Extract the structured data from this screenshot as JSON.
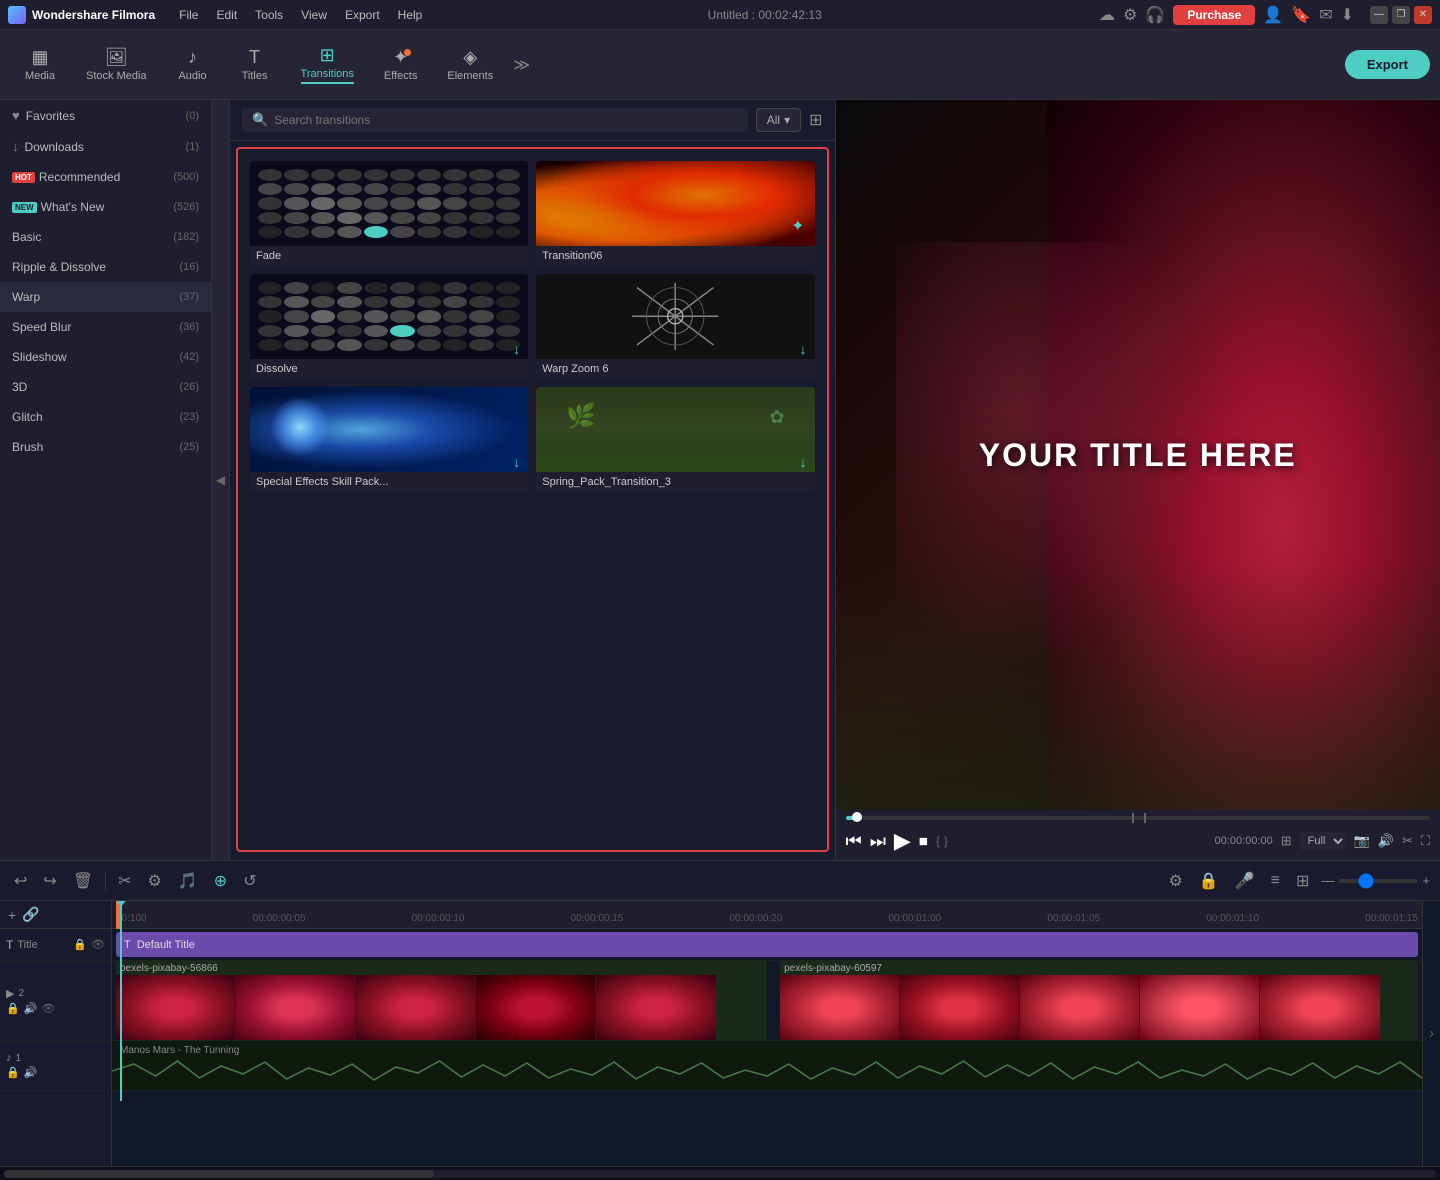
{
  "app": {
    "name": "Wondershare Filmora",
    "title": "Untitled : 00:02:42:13"
  },
  "titlebar": {
    "menus": [
      "File",
      "Edit",
      "Tools",
      "View",
      "Export",
      "Help"
    ],
    "purchase_label": "Purchase",
    "win_controls": [
      "—",
      "❐",
      "✕"
    ]
  },
  "toolbar": {
    "items": [
      {
        "id": "media",
        "icon": "▦",
        "label": "Media",
        "active": false
      },
      {
        "id": "stock-media",
        "icon": "🖼",
        "label": "Stock Media",
        "active": false
      },
      {
        "id": "audio",
        "icon": "♪",
        "label": "Audio",
        "active": false
      },
      {
        "id": "titles",
        "icon": "T",
        "label": "Titles",
        "active": false
      },
      {
        "id": "transitions",
        "icon": "⊞",
        "label": "Transitions",
        "active": true
      },
      {
        "id": "effects",
        "icon": "✦",
        "label": "Effects",
        "active": false,
        "dot": true
      },
      {
        "id": "elements",
        "icon": "◈",
        "label": "Elements",
        "active": false
      }
    ],
    "export_label": "Export"
  },
  "sidebar": {
    "items": [
      {
        "id": "favorites",
        "label": "Favorites",
        "count": "(0)",
        "icon": "♥"
      },
      {
        "id": "downloads",
        "label": "Downloads",
        "count": "(1)",
        "icon": "↓"
      },
      {
        "id": "recommended",
        "label": "Recommended",
        "count": "(500)",
        "badge": "HOT"
      },
      {
        "id": "whats-new",
        "label": "What's New",
        "count": "(526)",
        "badge": "NEW"
      },
      {
        "id": "basic",
        "label": "Basic",
        "count": "(182)"
      },
      {
        "id": "ripple",
        "label": "Ripple & Dissolve",
        "count": "(16)"
      },
      {
        "id": "warp",
        "label": "Warp",
        "count": "(37)"
      },
      {
        "id": "speed-blur",
        "label": "Speed Blur",
        "count": "(36)"
      },
      {
        "id": "slideshow",
        "label": "Slideshow",
        "count": "(42)"
      },
      {
        "id": "3d",
        "label": "3D",
        "count": "(26)"
      },
      {
        "id": "glitch",
        "label": "Glitch",
        "count": "(23)"
      },
      {
        "id": "brush",
        "label": "Brush",
        "count": "(25)"
      }
    ]
  },
  "search": {
    "placeholder": "Search transitions",
    "filter_label": "All"
  },
  "transitions": [
    {
      "id": "fade",
      "label": "Fade",
      "type": "dots"
    },
    {
      "id": "transition06",
      "label": "Transition06",
      "type": "fire"
    },
    {
      "id": "dissolve",
      "label": "Dissolve",
      "type": "dissolve"
    },
    {
      "id": "warp-zoom-6",
      "label": "Warp Zoom 6",
      "type": "warp"
    },
    {
      "id": "special-effects",
      "label": "Special Effects Skill Pack...",
      "type": "special",
      "has_download": true
    },
    {
      "id": "spring-pack",
      "label": "Spring_Pack_Transition_3",
      "type": "spring",
      "has_download": true
    }
  ],
  "preview": {
    "title_text": "YOUR TITLE HERE",
    "timecode": "00:00:00:00",
    "quality": "Full"
  },
  "timeline": {
    "tracks": [
      {
        "id": "title-track",
        "label": "Default Title",
        "icon": "T",
        "type": "title"
      },
      {
        "id": "video1",
        "label": "pexels-pixabay-56866",
        "icon": "▶",
        "type": "video"
      },
      {
        "id": "video2",
        "label": "pexels-pixabay-60597",
        "icon": "▶",
        "type": "video"
      },
      {
        "id": "audio",
        "label": "Manos Mars - The Tunning",
        "icon": "♪",
        "type": "audio"
      }
    ],
    "ruler": [
      "00:100",
      "00:00:00:05",
      "00:00:00:10",
      "00:00:00:15",
      "00:00:00:20",
      "00:00:01:00",
      "00:00:01:05",
      "00:00:01:10",
      "00:00:01:15"
    ]
  }
}
